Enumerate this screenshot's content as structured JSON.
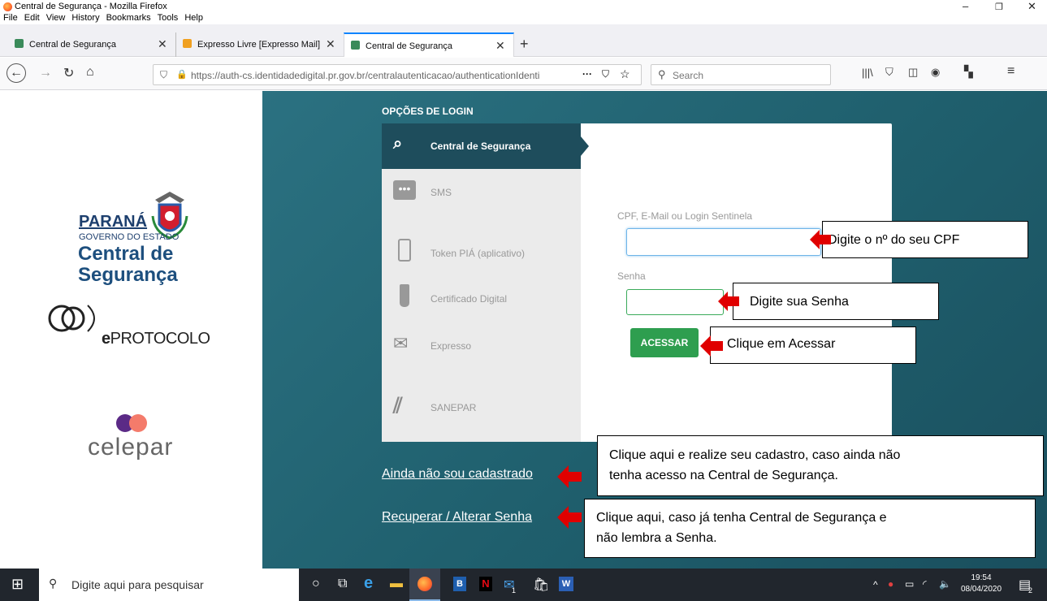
{
  "window": {
    "title": "Central de Segurança - Mozilla Firefox"
  },
  "menu": [
    "File",
    "Edit",
    "View",
    "History",
    "Bookmarks",
    "Tools",
    "Help"
  ],
  "tabs": [
    {
      "label": "Central de Segurança"
    },
    {
      "label": "Expresso Livre [Expresso Mail]"
    },
    {
      "label": "Central de Segurança"
    }
  ],
  "nav": {
    "url": "https://auth-cs.identidadedigital.pr.gov.br/centralautenticacao/authenticationIdenti",
    "url_host": "identidadedigital.pr.gov.br",
    "search_placeholder": "Search"
  },
  "brand": {
    "parana": "PARANÁ",
    "governo": "GOVERNO DO ESTADO",
    "central1": "Central de",
    "central2": "Segurança",
    "eprotocolo_e": "e",
    "eprotocolo": "PROTOCOLO",
    "celepar": "celepar"
  },
  "login": {
    "heading": "OPÇÕES DE LOGIN",
    "options": [
      {
        "label": "Central de Segurança",
        "icon": "search-key-icon"
      },
      {
        "label": "SMS",
        "icon": "chat-icon"
      },
      {
        "label": "Token PIÁ (aplicativo)",
        "icon": "phone-icon"
      },
      {
        "label": "Certificado Digital",
        "icon": "usb-icon"
      },
      {
        "label": "Expresso",
        "icon": "mail-icon"
      },
      {
        "label": "SANEPAR",
        "icon": "sanepar-icon"
      }
    ],
    "cpf_label": "CPF, E-Mail ou Login Sentinela",
    "senha_label": "Senha",
    "submit": "ACESSAR",
    "register_link": "Ainda não sou cadastrado",
    "recover_link": "Recuperar / Alterar Senha"
  },
  "annotations": {
    "cpf": "Digite o nº do seu CPF",
    "senha": "Digite sua Senha",
    "acessar": "Clique em Acessar",
    "cadastro_line1": "Clique aqui e realize seu cadastro, caso ainda não",
    "cadastro_line2": "tenha acesso na Central de Segurança.",
    "recuperar_line1": "Clique aqui, caso já tenha Central de Segurança e",
    "recuperar_line2": "não lembra a Senha."
  },
  "taskbar": {
    "search_placeholder": "Digite aqui para pesquisar",
    "time": "19:54",
    "date": "08/04/2020",
    "notif_count": "2",
    "mail_badge": "1"
  },
  "colors": {
    "teal_panel": "#236a79",
    "active_option": "#1e4d5c",
    "acessar_button": "#2e9e4f",
    "arrow_red": "#e00000"
  }
}
